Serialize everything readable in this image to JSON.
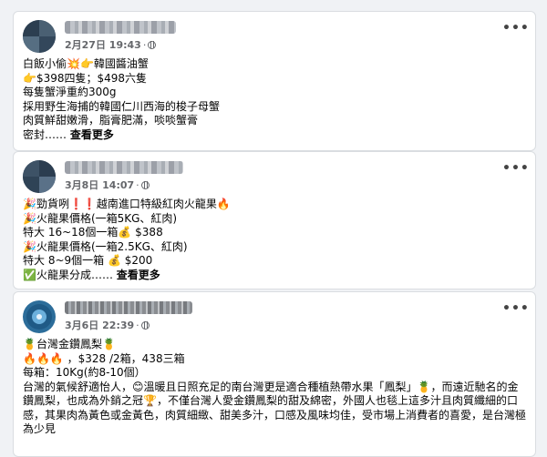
{
  "posts": [
    {
      "timestamp": "2月27日 19:43",
      "lines": [
        "白飯小偷💥👉韓國醬油蟹",
        "👉$398四隻；$498六隻",
        " 每隻蟹淨重約300g",
        " 採用野生海捕的韓國仁川西海的梭子母蟹",
        " 肉質鮮甜嫩滑，脂膏肥滿，啖啖蟹膏",
        " 密封……"
      ],
      "see_more": "查看更多"
    },
    {
      "timestamp": "3月8日 14:07",
      "lines": [
        "🎉勁貨咧❗❗越南進口特級紅肉火龍果🔥",
        "🎉火龍果價格(一箱5KG、紅肉)",
        "特大 16~18個一箱💰 $388",
        "🎉火龍果價格(一箱2.5KG、紅肉)",
        "特大 8~9個一箱 💰 $200",
        "✅火龍果分成……"
      ],
      "see_more": "查看更多"
    },
    {
      "timestamp": "3月6日 22:39",
      "lines": [
        "🍍台灣金鑽鳳梨🍍",
        "🔥🔥🔥 ，$328 /2箱，438三箱",
        "每箱：10Kg(約8-10個）",
        "台灣的氣候舒適怡人，😊溫暖且日照充足的南台灣更是適合種植熱帶水果「鳳梨」🍍，而遠近馳名的金鑽鳳梨，也成為外銷之冠🏆，不僅台灣人愛金鑽鳳梨的甜及綿密，外國人也毯上這多汁且肉質纖細的口感，其果肉為黃色或金黃色，肉質細緻、甜美多汁，口感及風味均佳，受市場上消費者的喜愛，是台灣極為少見"
      ]
    }
  ],
  "icons": {
    "privacy": "globe-icon",
    "menu": "more-horizontal-icon"
  },
  "more_glyph": "•••"
}
